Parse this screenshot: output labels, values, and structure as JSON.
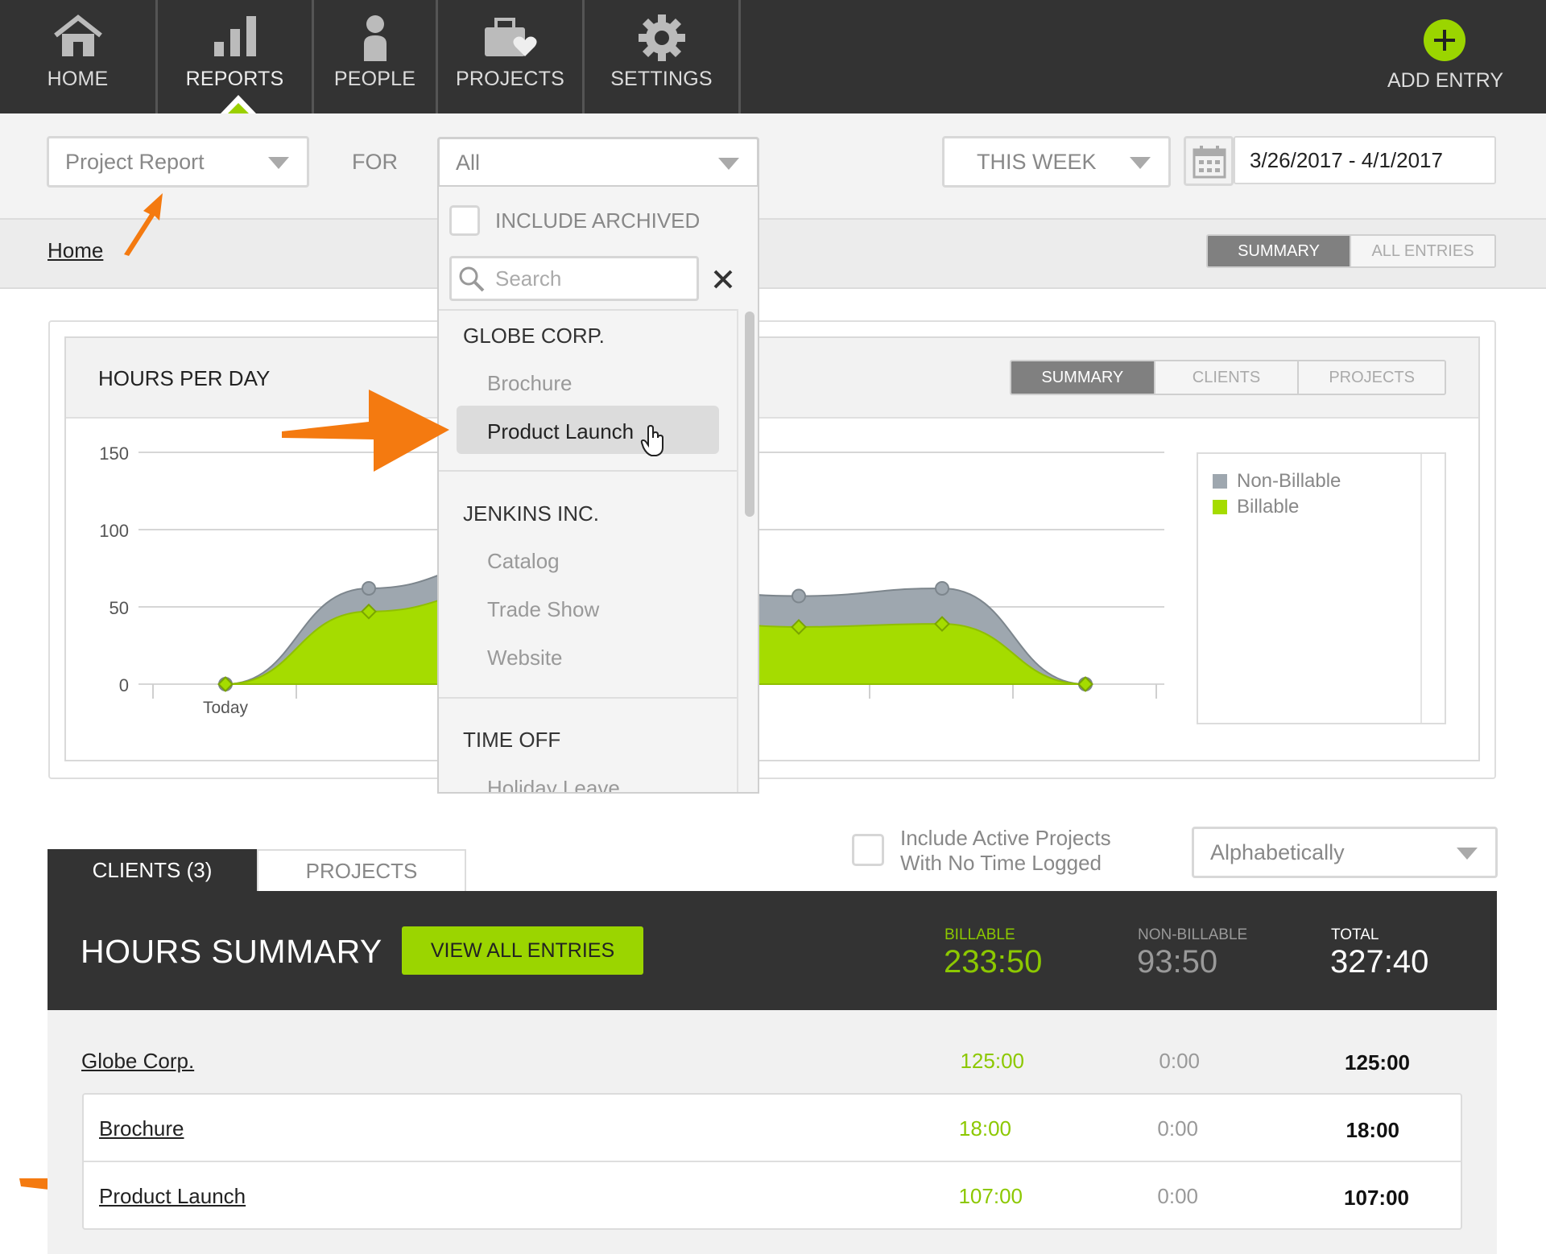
{
  "nav": {
    "items": [
      {
        "label": "HOME",
        "icon": "home-icon"
      },
      {
        "label": "REPORTS",
        "icon": "bar-chart-icon"
      },
      {
        "label": "PEOPLE",
        "icon": "person-icon"
      },
      {
        "label": "PROJECTS",
        "icon": "briefcase-heart-icon"
      },
      {
        "label": "SETTINGS",
        "icon": "gear-icon"
      }
    ],
    "active": "REPORTS",
    "add_entry": "ADD ENTRY"
  },
  "filters": {
    "report_type": "Project Report",
    "for_label": "FOR",
    "for_value": "All",
    "period": "THIS WEEK",
    "date_range": "3/26/2017 - 4/1/2017"
  },
  "breadcrumb": {
    "home": "Home"
  },
  "view_toggle": {
    "summary": "SUMMARY",
    "all_entries": "ALL ENTRIES",
    "active": "SUMMARY"
  },
  "dropdown": {
    "include_archived": "INCLUDE ARCHIVED",
    "search_placeholder": "Search",
    "groups": [
      {
        "name": "GLOBE CORP.",
        "items": [
          "Brochure",
          "Product Launch"
        ]
      },
      {
        "name": "JENKINS INC.",
        "items": [
          "Catalog",
          "Trade Show",
          "Website"
        ]
      },
      {
        "name": "TIME OFF",
        "items": [
          "Holiday Leave"
        ]
      }
    ],
    "highlighted": "Product Launch"
  },
  "chart_panel": {
    "title": "HOURS PER DAY",
    "tabs": [
      "SUMMARY",
      "CLIENTS",
      "PROJECTS"
    ],
    "active_tab": "SUMMARY",
    "legend": [
      "Non-Billable",
      "Billable"
    ],
    "y_ticks": [
      "150",
      "100",
      "50",
      "0"
    ],
    "x_first_label": "Today"
  },
  "chart_data": {
    "type": "area",
    "title": "HOURS PER DAY",
    "ylim": [
      0,
      150
    ],
    "y_ticks": [
      0,
      50,
      100,
      150
    ],
    "x": [
      "Today",
      "",
      "",
      "",
      "",
      "",
      ""
    ],
    "series": [
      {
        "name": "Billable",
        "values": [
          0,
          47,
          62,
          null,
          37,
          39,
          0
        ],
        "color": "#a5dc00"
      },
      {
        "name": "Non-Billable",
        "values": [
          0,
          62,
          80,
          null,
          57,
          62,
          0
        ],
        "color": "#9ea7af"
      }
    ],
    "legend_position": "right",
    "grid": true
  },
  "options": {
    "include_active": [
      "Include Active Projects",
      "With No Time Logged"
    ],
    "sort": "Alphabetically"
  },
  "tabs": {
    "clients": "CLIENTS (3)",
    "projects": "PROJECTS",
    "active": "clients"
  },
  "summary": {
    "title": "HOURS SUMMARY",
    "button": "VIEW ALL ENTRIES",
    "billable_label": "BILLABLE",
    "billable": "233:50",
    "nonbillable_label": "NON-BILLABLE",
    "nonbillable": "93:50",
    "total_label": "TOTAL",
    "total": "327:40"
  },
  "rows": [
    {
      "name": "Globe Corp.",
      "billable": "125:00",
      "nonbillable": "0:00",
      "total": "125:00"
    },
    {
      "name": "Brochure",
      "billable": "18:00",
      "nonbillable": "0:00",
      "total": "18:00"
    },
    {
      "name": "Product Launch",
      "billable": "107:00",
      "nonbillable": "0:00",
      "total": "107:00"
    }
  ],
  "colors": {
    "accent": "#9bd500",
    "dark": "#333333",
    "annotation": "#f47a10"
  }
}
